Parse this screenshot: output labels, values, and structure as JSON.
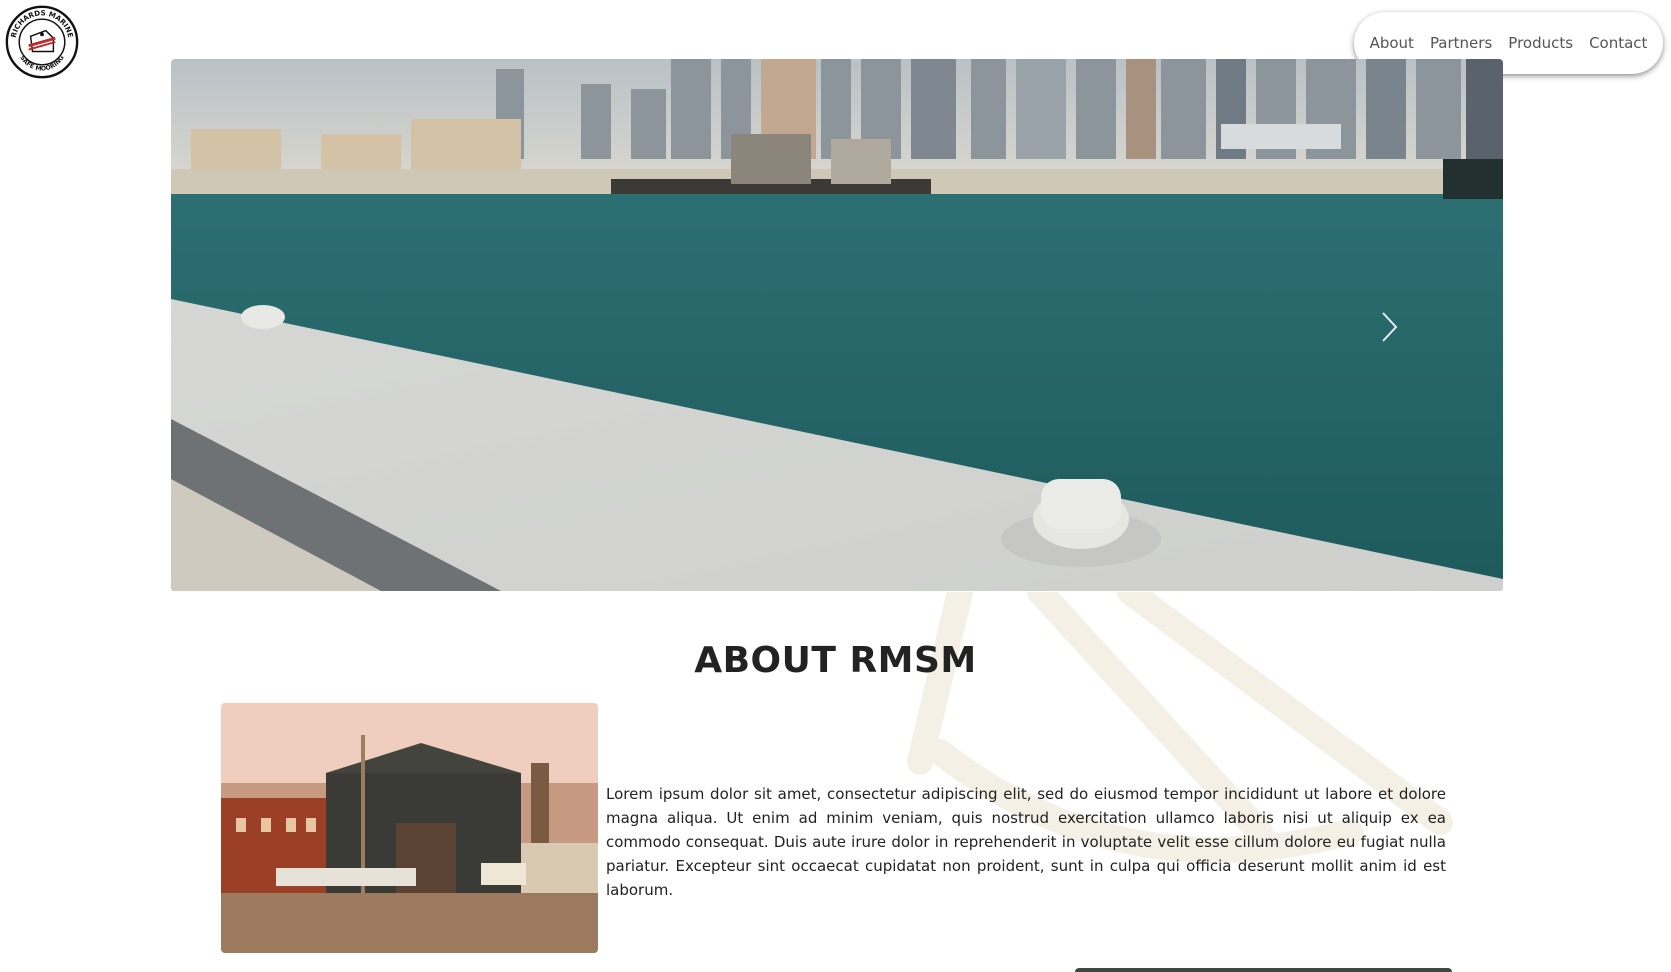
{
  "logo": {
    "text_top": "RICHARDS MARINE",
    "text_bottom": "SAFE MOORING"
  },
  "nav": {
    "items": [
      "About",
      "Partners",
      "Products",
      "Contact"
    ]
  },
  "hero": {
    "next_icon": "chevron-right-icon"
  },
  "about": {
    "title": "ABOUT RMSM",
    "body": "Lorem ipsum dolor sit amet, consectetur adipiscing elit, sed do eiusmod tempor incididunt ut labore et dolore magna aliqua. Ut enim ad minim veniam, quis nostrud exercitation ullamco laboris nisi ut aliquip ex ea commodo consequat. Duis aute irure dolor in reprehenderit in voluptate velit esse cillum dolore eu fugiat nulla pariatur. Excepteur sint occaecat cupidatat non proident, sunt in culpa qui officia deserunt mollit anim id est laborum."
  },
  "colors": {
    "water": "#1f6b6b",
    "concrete": "#d8d9d6",
    "accent_red": "#c0282d"
  }
}
